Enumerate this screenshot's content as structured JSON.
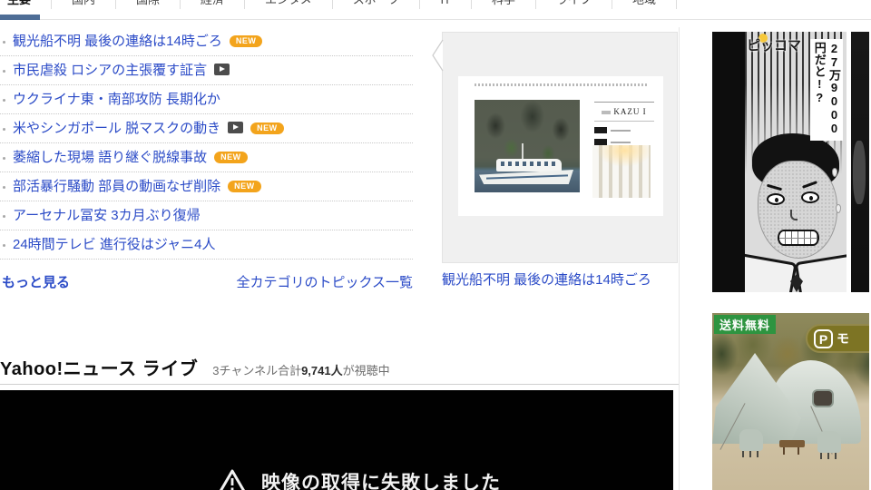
{
  "nav": {
    "tabs": [
      "主要",
      "国内",
      "国際",
      "経済",
      "エンタメ",
      "スポーツ",
      "IT",
      "科学",
      "ライフ",
      "地域"
    ],
    "selected_index": 0
  },
  "topics": {
    "new_badge": "NEW",
    "items": [
      {
        "text": "観光船不明 最後の連絡は14時ごろ",
        "video": false,
        "new": true
      },
      {
        "text": "市民虐殺 ロシアの主張覆す証言",
        "video": true,
        "new": false
      },
      {
        "text": "ウクライナ東・南部攻防 長期化か",
        "video": false,
        "new": false
      },
      {
        "text": "米やシンガポール 脱マスクの動き",
        "video": true,
        "new": true
      },
      {
        "text": "萎縮した現場 語り継ぐ脱線事故",
        "video": false,
        "new": true
      },
      {
        "text": "部活暴行騒動 部員の動画なぜ削除",
        "video": false,
        "new": true
      },
      {
        "text": "アーセナル冨安 3カ月ぶり復帰",
        "video": false,
        "new": false
      },
      {
        "text": "24時間テレビ 進行役はジャニ4人",
        "video": false,
        "new": false
      }
    ],
    "more_label": "もっと見る",
    "all_categories_label": "全カテゴリのトピックス一覧"
  },
  "preview": {
    "caption": "観光船不明 最後の連絡は14時ごろ",
    "boat_name": "KAZU I"
  },
  "ads": {
    "manga": {
      "brand": "ピッコマ",
      "speech": "27万9000円だと!?"
    },
    "tent": {
      "badge": "送料無料",
      "logo_letter": "P",
      "store_text": "モ"
    }
  },
  "live": {
    "title": "Yahoo!ニュース ライブ",
    "viewers_prefix": "3チャンネル合計",
    "viewers_count": "9,741人",
    "viewers_suffix": "が視聴中",
    "error": "映像の取得に失敗しました"
  },
  "colors": {
    "link_blue": "#2b4bc7",
    "new_badge_orange": "#f3a41c",
    "tab_underline": "#4e6d96",
    "free_shipping_green": "#2e9440",
    "player_black": "#010101"
  }
}
